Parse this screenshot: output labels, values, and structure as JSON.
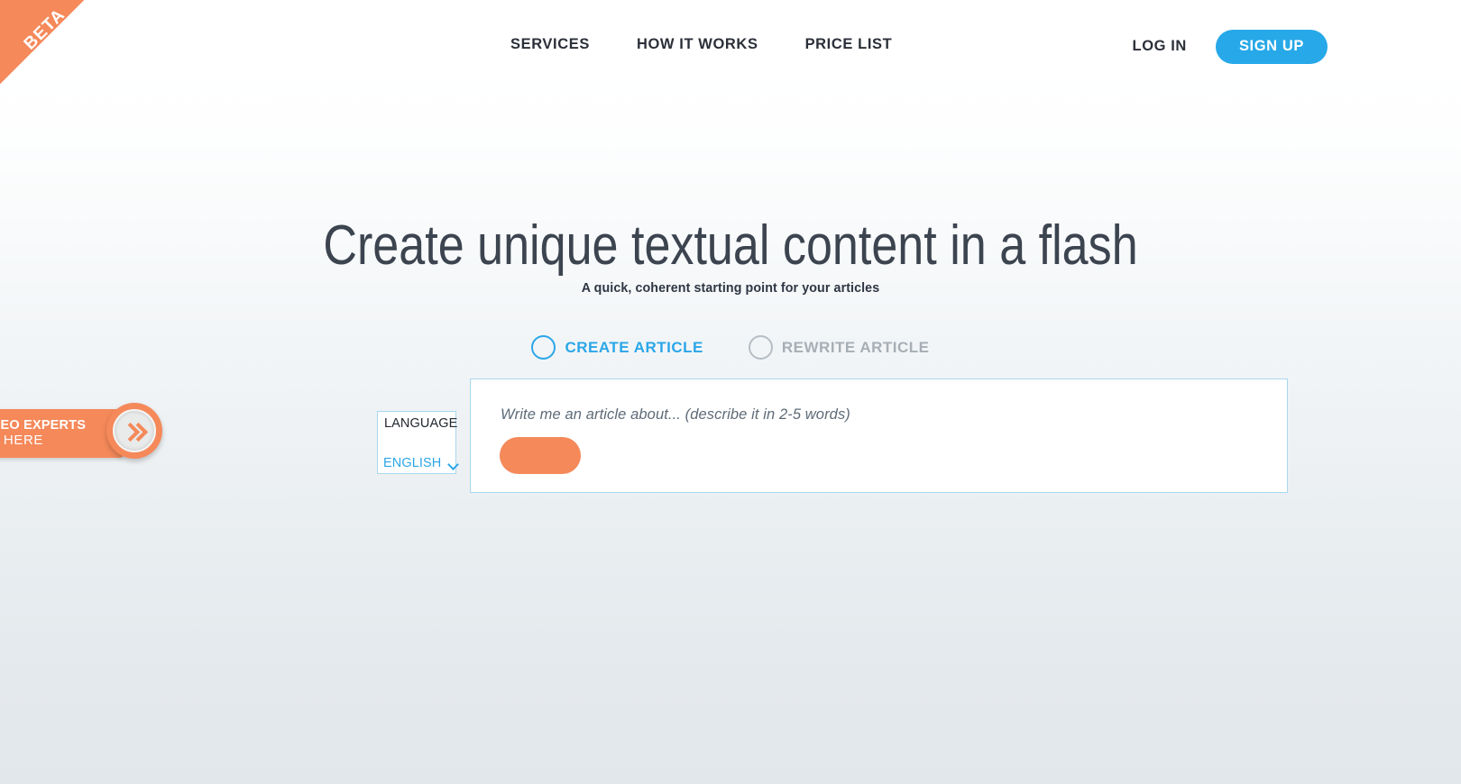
{
  "ribbon": {
    "label": "BETA"
  },
  "nav": {
    "items": [
      {
        "label": "SERVICES",
        "name": "nav-link-services"
      },
      {
        "label": "HOW IT WORKS",
        "name": "nav-link-how-it-works"
      },
      {
        "label": "PRICE LIST",
        "name": "nav-link-price-list"
      }
    ],
    "login_label": "LOG IN",
    "signup_label": "SIGN UP"
  },
  "hero": {
    "title": "Create unique textual content in a flash",
    "subtitle": "A quick, coherent starting point for your articles"
  },
  "modes": {
    "options": [
      {
        "label": "CREATE ARTICLE",
        "selected": true
      },
      {
        "label": "REWRITE ARTICLE",
        "selected": false
      }
    ]
  },
  "language": {
    "label": "LANGUAGE",
    "value": "ENGLISH",
    "chevron_icon": "chevron-down-icon"
  },
  "prompt": {
    "placeholder": "Write me an article about... (describe it in 2-5 words)",
    "value": "",
    "submit_label": ""
  },
  "promo": {
    "line1": "GENCIES & SEO EXPERTS",
    "line2": "CLICK HERE",
    "knob_icon": "double-chevron-right-icon"
  },
  "colors": {
    "accent_blue": "#27a8e8",
    "accent_orange": "#f5895a",
    "text_dark": "#2b2f38",
    "muted_gray": "#a7aeb5",
    "border_blue": "#a9d7ee"
  }
}
